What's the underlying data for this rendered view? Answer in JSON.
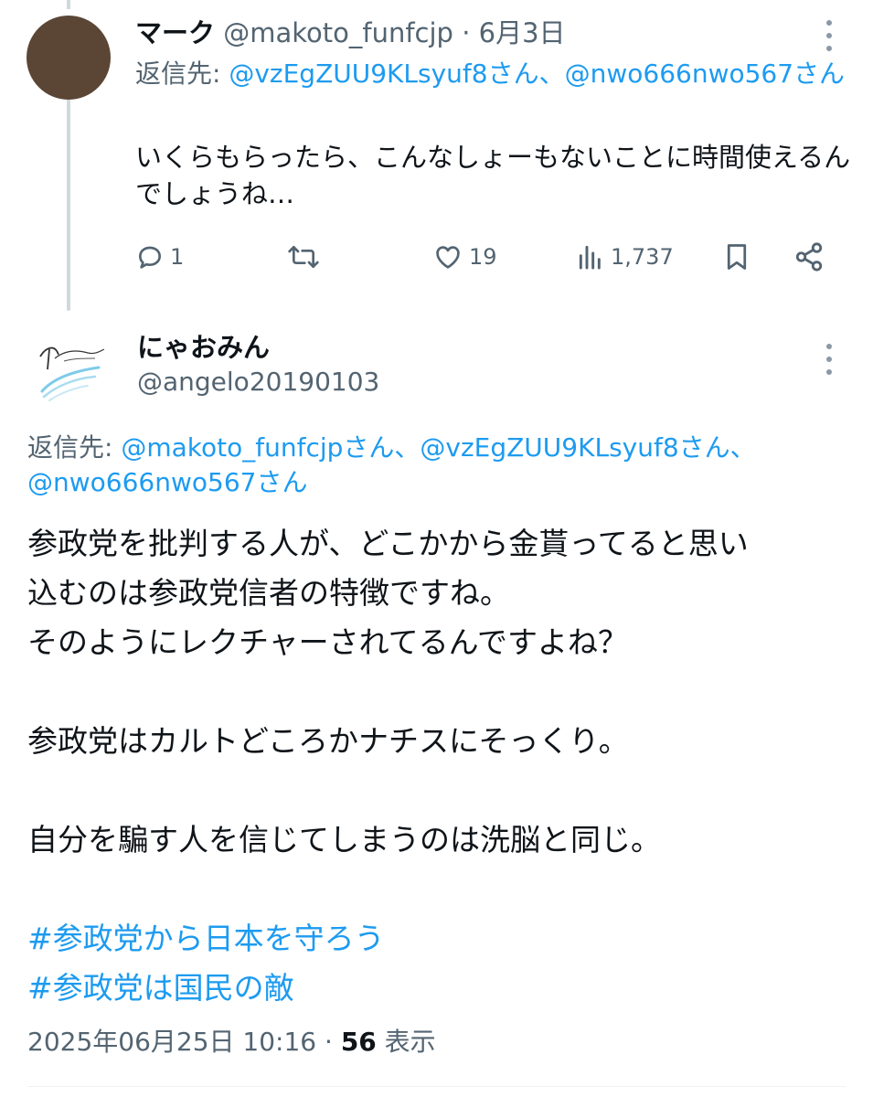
{
  "tweet1": {
    "display_name": "マーク",
    "handle": "@makoto_funfcjp",
    "separator": "·",
    "date": "6月3日",
    "reply_prefix": "返信先: ",
    "reply_to": "@vzEgZUU9KLsyuf8さん、@nwo666nwo567さん",
    "text": "いくらもらったら、こんなしょーもないことに時間使えるんでしょうね…",
    "avatar_color": "#5b4636",
    "actions": {
      "reply_icon": "reply-icon",
      "reply_count": "1",
      "retweet_icon": "retweet-icon",
      "like_icon": "heart-icon",
      "like_count": "19",
      "views_icon": "views-icon",
      "views_count": "1,737",
      "bookmark_icon": "bookmark-icon",
      "share_icon": "share-icon"
    }
  },
  "tweet2": {
    "display_name": "にゃおみん",
    "handle": "@angelo20190103",
    "reply_prefix": "返信先: ",
    "reply_to": "@makoto_funfcjpさん、@vzEgZUU9KLsyuf8さん、@nwo666nwo567さん",
    "body": {
      "p1_l1": "参政党を批判する人が、どこかから金貰ってると思い",
      "p1_l2": "込むのは参政党信者の特徴ですね。",
      "p1_l3": "そのようにレクチャーされてるんですよね？",
      "p2": "参政党はカルトどころかナチスにそっくり。",
      "p3": "自分を騙す人を信じてしまうのは洗脳と同じ。"
    },
    "hashtags": [
      "#参政党から日本を守ろう",
      "#参政党は国民の敵"
    ],
    "timestamp": "2025年06月25日 10:16",
    "separator": " · ",
    "views_count": "56",
    "views_label": " 表示"
  },
  "colors": {
    "accent": "#1d9bf0",
    "secondary_text": "#536471",
    "primary_text": "#0f1419",
    "thread_line": "#cfd9de"
  }
}
